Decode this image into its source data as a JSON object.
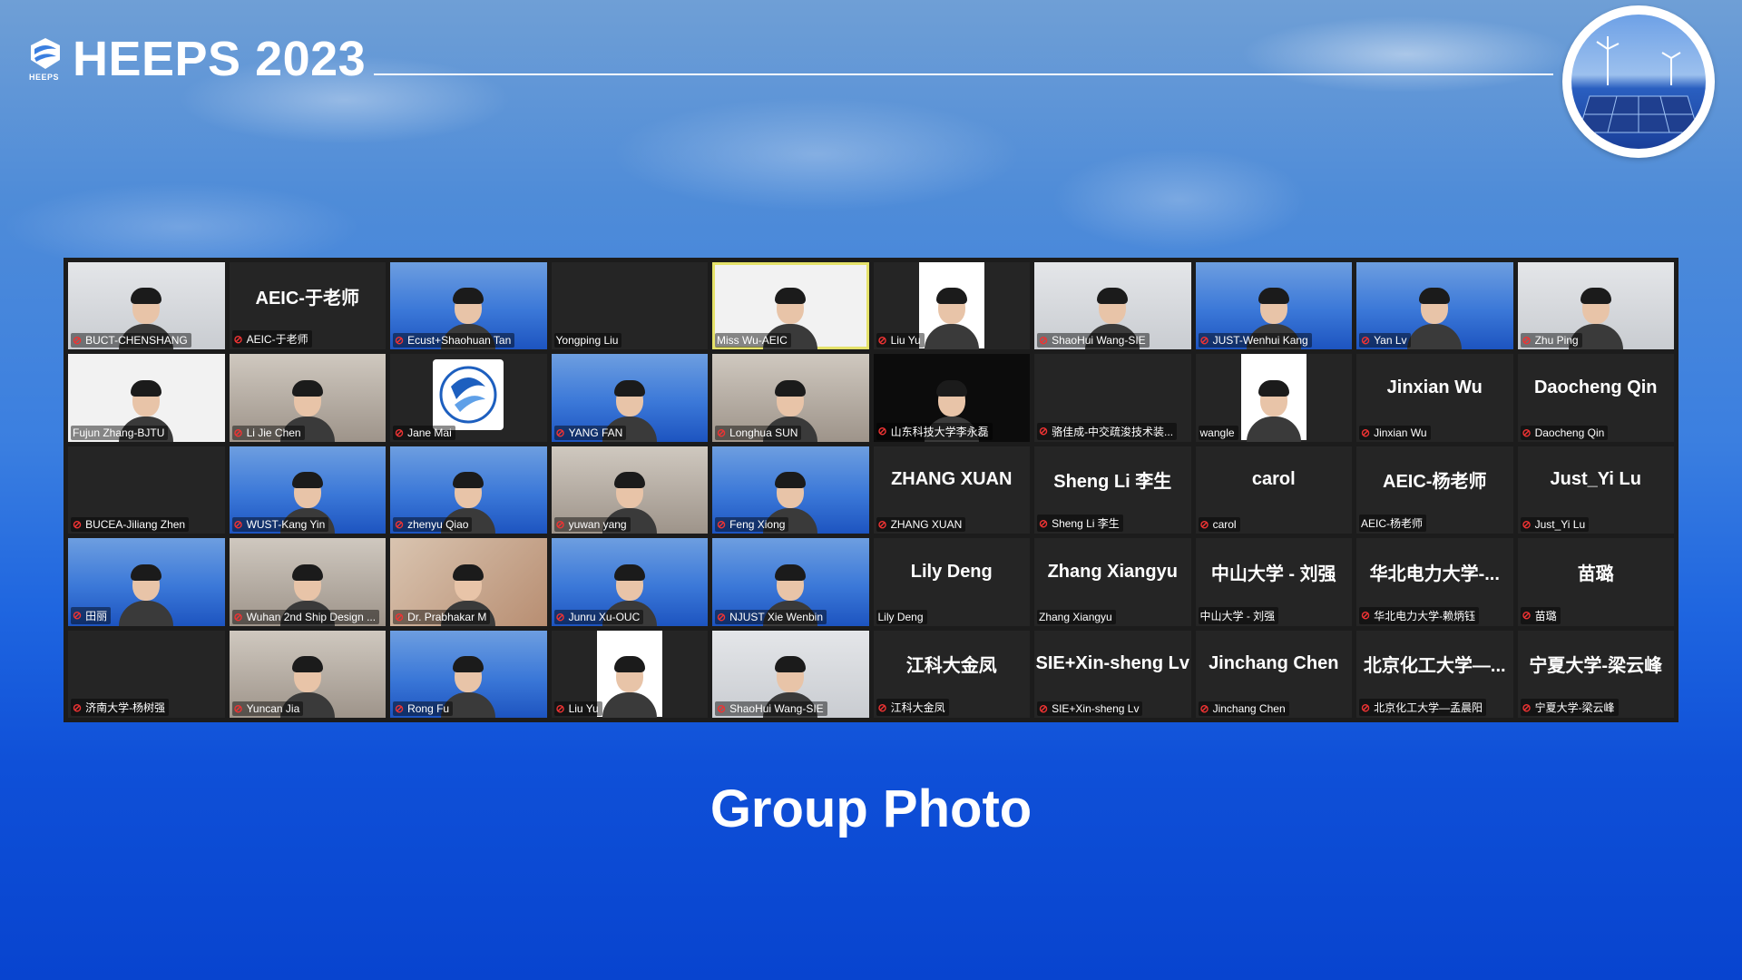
{
  "header": {
    "logo_small_text": "HEEPS",
    "title": "HEEPS 2023"
  },
  "caption": "Group Photo",
  "meeting": {
    "tiles": [
      {
        "name": "BUCT-CHENSHANG",
        "muted": true,
        "display": "",
        "bg": "office",
        "face": true
      },
      {
        "name": "AEIC-于老师",
        "muted": true,
        "display": "AEIC-于老师",
        "bg": "none",
        "face": false
      },
      {
        "name": "Ecust+Shaohuan Tan",
        "muted": true,
        "display": "",
        "bg": "blue",
        "face": true
      },
      {
        "name": "Yongping Liu",
        "muted": false,
        "display": "",
        "bg": "none",
        "face": false
      },
      {
        "name": "Miss Wu-AEIC",
        "muted": false,
        "display": "",
        "bg": "white",
        "face": true,
        "active": true
      },
      {
        "name": "Liu Yu",
        "muted": true,
        "display": "",
        "bg": "none",
        "face": true,
        "portrait": true
      },
      {
        "name": "ShaoHui Wang-SIE",
        "muted": true,
        "display": "",
        "bg": "office",
        "face": true
      },
      {
        "name": "JUST-Wenhui Kang",
        "muted": true,
        "display": "",
        "bg": "blue",
        "face": true
      },
      {
        "name": "Yan Lv",
        "muted": true,
        "display": "",
        "bg": "blue",
        "face": true
      },
      {
        "name": "Zhu Ping",
        "muted": true,
        "display": "",
        "bg": "office",
        "face": true
      },
      {
        "name": "Fujun Zhang-BJTU",
        "muted": false,
        "display": "",
        "bg": "white",
        "face": true
      },
      {
        "name": "Li Jie Chen",
        "muted": true,
        "display": "",
        "bg": "room",
        "face": true
      },
      {
        "name": "Jane Mai",
        "muted": true,
        "display": "",
        "bg": "none",
        "face": false,
        "logo": true
      },
      {
        "name": "YANG FAN",
        "muted": true,
        "display": "",
        "bg": "blue",
        "face": true
      },
      {
        "name": "Longhua SUN",
        "muted": true,
        "display": "",
        "bg": "room",
        "face": true
      },
      {
        "name": "山东科技大学李永磊",
        "muted": true,
        "display": "",
        "bg": "dark",
        "face": true
      },
      {
        "name": "骆佳成-中交疏浚技术装...",
        "muted": true,
        "display": "",
        "bg": "none",
        "face": false
      },
      {
        "name": "wangle",
        "muted": false,
        "display": "",
        "bg": "none",
        "face": true,
        "portrait": true
      },
      {
        "name": "Jinxian Wu",
        "muted": true,
        "display": "Jinxian Wu",
        "bg": "none",
        "face": false
      },
      {
        "name": "Daocheng Qin",
        "muted": true,
        "display": "Daocheng Qin",
        "bg": "none",
        "face": false
      },
      {
        "name": "BUCEA-Jiliang Zhen",
        "muted": true,
        "display": "",
        "bg": "none",
        "face": false
      },
      {
        "name": "WUST-Kang Yin",
        "muted": true,
        "display": "",
        "bg": "blue",
        "face": true
      },
      {
        "name": "zhenyu Qiao",
        "muted": true,
        "display": "",
        "bg": "blue",
        "face": true
      },
      {
        "name": "yuwan yang",
        "muted": true,
        "display": "",
        "bg": "room",
        "face": true
      },
      {
        "name": "Feng Xiong",
        "muted": true,
        "display": "",
        "bg": "blue",
        "face": true
      },
      {
        "name": "ZHANG XUAN",
        "muted": true,
        "display": "ZHANG XUAN",
        "bg": "none",
        "face": false
      },
      {
        "name": "Sheng Li 李生",
        "muted": true,
        "display": "Sheng Li 李生",
        "bg": "none",
        "face": false
      },
      {
        "name": "carol",
        "muted": true,
        "display": "carol",
        "bg": "none",
        "face": false
      },
      {
        "name": "AEIC-杨老师",
        "muted": false,
        "display": "AEIC-杨老师",
        "bg": "none",
        "face": false
      },
      {
        "name": "Just_Yi Lu",
        "muted": true,
        "display": "Just_Yi Lu",
        "bg": "none",
        "face": false
      },
      {
        "name": "田丽",
        "muted": true,
        "display": "",
        "bg": "blue",
        "face": true
      },
      {
        "name": "Wuhan 2nd Ship Design ...",
        "muted": true,
        "display": "",
        "bg": "room",
        "face": true
      },
      {
        "name": "Dr. Prabhakar M",
        "muted": true,
        "display": "",
        "bg": "warm",
        "face": true
      },
      {
        "name": "Junru Xu-OUC",
        "muted": true,
        "display": "",
        "bg": "blue",
        "face": true
      },
      {
        "name": "NJUST Xie Wenbin",
        "muted": true,
        "display": "",
        "bg": "blue",
        "face": true
      },
      {
        "name": "Lily Deng",
        "muted": false,
        "display": "Lily Deng",
        "bg": "none",
        "face": false
      },
      {
        "name": "Zhang Xiangyu",
        "muted": false,
        "display": "Zhang Xiangyu",
        "bg": "none",
        "face": false
      },
      {
        "name": "中山大学 - 刘强",
        "muted": false,
        "display": "中山大学 - 刘强",
        "bg": "none",
        "face": false
      },
      {
        "name": "华北电力大学-赖炳钰",
        "muted": true,
        "display": "华北电力大学-...",
        "bg": "none",
        "face": false
      },
      {
        "name": "苗璐",
        "muted": true,
        "display": "苗璐",
        "bg": "none",
        "face": false
      },
      {
        "name": "济南大学-杨树强",
        "muted": true,
        "display": "",
        "bg": "none",
        "face": false
      },
      {
        "name": "Yuncan Jia",
        "muted": true,
        "display": "",
        "bg": "room",
        "face": true
      },
      {
        "name": "Rong Fu",
        "muted": true,
        "display": "",
        "bg": "blue",
        "face": true
      },
      {
        "name": "Liu Yu",
        "muted": true,
        "display": "",
        "bg": "none",
        "face": true,
        "portrait": true
      },
      {
        "name": "ShaoHui Wang-SIE",
        "muted": true,
        "display": "",
        "bg": "office",
        "face": true
      },
      {
        "name": "江科大金凤",
        "muted": true,
        "display": "江科大金凤",
        "bg": "none",
        "face": false
      },
      {
        "name": "SIE+Xin-sheng Lv",
        "muted": true,
        "display": "SIE+Xin-sheng Lv",
        "bg": "none",
        "face": false
      },
      {
        "name": "Jinchang Chen",
        "muted": true,
        "display": "Jinchang Chen",
        "bg": "none",
        "face": false
      },
      {
        "name": "北京化工大学—孟晨阳",
        "muted": true,
        "display": "北京化工大学—...",
        "bg": "none",
        "face": false
      },
      {
        "name": "宁夏大学-梁云峰",
        "muted": true,
        "display": "宁夏大学-梁云峰",
        "bg": "none",
        "face": false
      }
    ]
  },
  "icons": {
    "mic_muted": "microphone-muted-icon"
  },
  "colors": {
    "active_speaker": "#e5e26a",
    "muted_mic": "#ee3333",
    "grid_bg": "#1c1c1c"
  }
}
